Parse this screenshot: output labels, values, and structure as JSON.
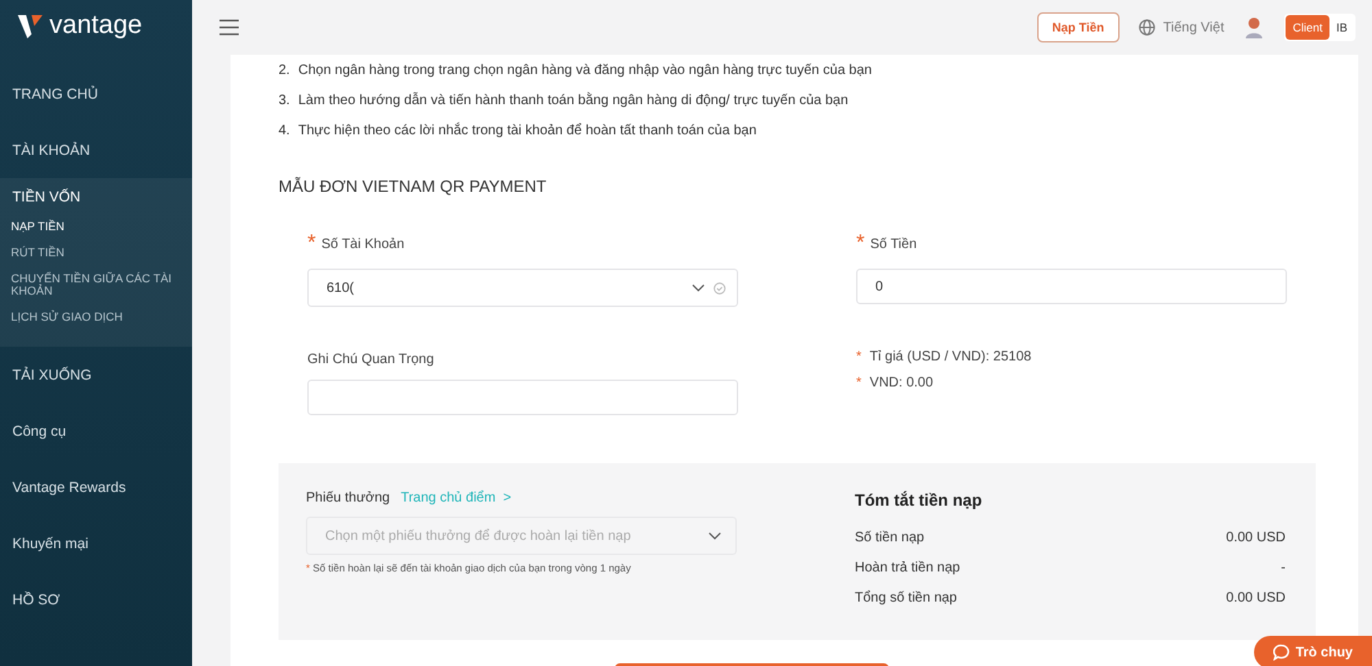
{
  "sidebar": {
    "logo": "vantage",
    "items": [
      {
        "label": "TRANG CHỦ",
        "selected": false
      },
      {
        "label": "TÀI KHOẢN",
        "selected": false
      },
      {
        "label": "TIỀN VỐN",
        "selected": true,
        "children": [
          {
            "label": "NẠP TIỀN",
            "selected": true
          },
          {
            "label": "RÚT TIỀN",
            "selected": false
          },
          {
            "label": "CHUYỂN TIỀN GIỮA CÁC TÀI KHOẢN",
            "selected": false
          },
          {
            "label": "LỊCH SỬ GIAO DỊCH",
            "selected": false
          }
        ]
      },
      {
        "label": "TẢI XUỐNG",
        "selected": false
      },
      {
        "label": "Công cụ",
        "selected": false
      },
      {
        "label": "Vantage Rewards",
        "selected": false
      },
      {
        "label": "Khuyến mại",
        "selected": false
      },
      {
        "label": "HỒ SƠ",
        "selected": false
      }
    ]
  },
  "topbar": {
    "deposit_button": "Nạp Tiền",
    "language": "Tiếng Việt",
    "modes": [
      {
        "label": "Client",
        "selected": true
      },
      {
        "label": "IB",
        "selected": false
      }
    ]
  },
  "steps": [
    {
      "number": "2.",
      "text": "Chọn ngân hàng trong trang chọn ngân hàng và đăng nhập vào ngân hàng trực tuyến của bạn"
    },
    {
      "number": "3.",
      "text": "Làm theo hướng dẫn và tiến hành thanh toán bằng ngân hàng di động/ trực tuyến của bạn"
    },
    {
      "number": "4.",
      "text": "Thực hiện theo các lời nhắc trong tài khoản để hoàn tất thanh toán của bạn"
    }
  ],
  "form_title": "MẪU ĐƠN VIETNAM QR PAYMENT",
  "account": {
    "mark": "*",
    "label": "Số Tài Khoản",
    "value": "610("
  },
  "amount": {
    "mark": "*",
    "label": "Số Tiền",
    "value": "0"
  },
  "note": {
    "label": "Ghi Chú Quan Trọng"
  },
  "rates": [
    {
      "mark": "*",
      "text": "Tỉ giá (USD / VND): 25108"
    },
    {
      "mark": "*",
      "text": "VND: 0.00"
    }
  ],
  "voucher": {
    "label": "Phiếu thưởng",
    "link": "Trang chủ điểm",
    "link_arrow": ">",
    "placeholder": "Chọn một phiếu thưởng để được hoàn lại tiền nạp",
    "hint_mark": "*",
    "hint": "Số tiền hoàn lại sẽ đến tài khoản giao dịch của bạn trong vòng 1 ngày"
  },
  "summary": {
    "title": "Tóm tắt tiền nạp",
    "rows": [
      {
        "label": "Số tiền nạp",
        "value": "0.00 USD"
      },
      {
        "label": "Hoàn trả tiền nạp",
        "value": "-"
      },
      {
        "label": "Tổng số tiền nạp",
        "value": "0.00 USD"
      }
    ]
  },
  "chat": {
    "label": "Trò chuy"
  }
}
